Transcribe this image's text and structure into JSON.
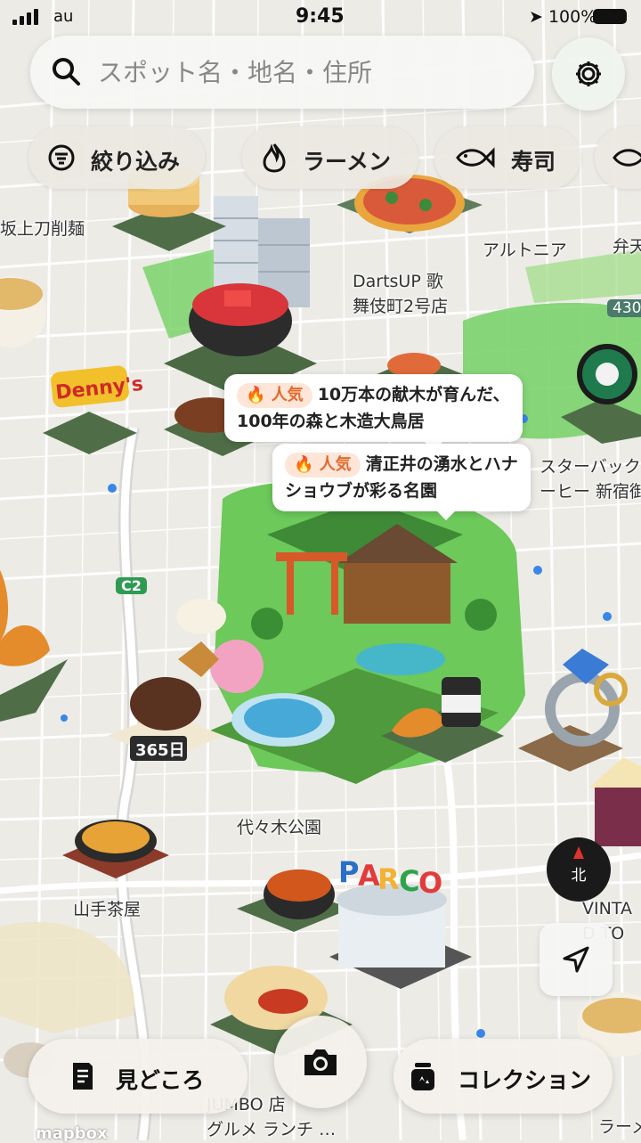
{
  "status_bar": {
    "carrier": "au",
    "time": "9:45",
    "battery": "100%"
  },
  "search": {
    "placeholder": "スポット名・地名・住所"
  },
  "icons": {
    "search": "search-icon",
    "settings": "gear-icon",
    "filter": "filter-icon",
    "ramen": "flame-icon",
    "sushi": "fish-icon",
    "camera": "camera-icon",
    "locate": "location-arrow-icon",
    "spots": "document-icon",
    "collection": "collection-icon",
    "compass": "compass-icon"
  },
  "chips": [
    {
      "label": "絞り込み"
    },
    {
      "label": "ラーメン"
    },
    {
      "label": "寿司"
    }
  ],
  "callouts": [
    {
      "badge": "人気",
      "text1": "10万本の献木が育んだ、",
      "text2": "100年の森と木造大鳥居"
    },
    {
      "badge": "人気",
      "text1": "清正井の湧水とハナ",
      "text2": "ショウブが彩る名園"
    }
  ],
  "map_labels": {
    "tachikezuri": "坂上刀削麺",
    "darts_1": "DartsUP 歌",
    "darts_2": "舞伎町2号店",
    "alto": "アルトニア",
    "bento": "弁天",
    "route_430": "430",
    "starbucks_1": "スターバック",
    "starbucks_2": "ーヒー 新宿御",
    "c2": "C2",
    "yoyogi": "代々木公園",
    "sannou": "山手茶屋",
    "vintage_1": "VINTA",
    "vintage_2": "D TO",
    "jambo_1": "JUMBO 店",
    "jambo_2": "グルメ ランチ …",
    "ramen_bottom": "ラーメ",
    "compass_north": "北",
    "mapbox": "mapbox"
  },
  "bottom_nav": {
    "spots": "見どころ",
    "collection": "コレクション"
  },
  "colors": {
    "accent": "#e2692c",
    "badge_bg": "#fde6d8",
    "park": "#7bd36b",
    "road": "#ffffff"
  }
}
